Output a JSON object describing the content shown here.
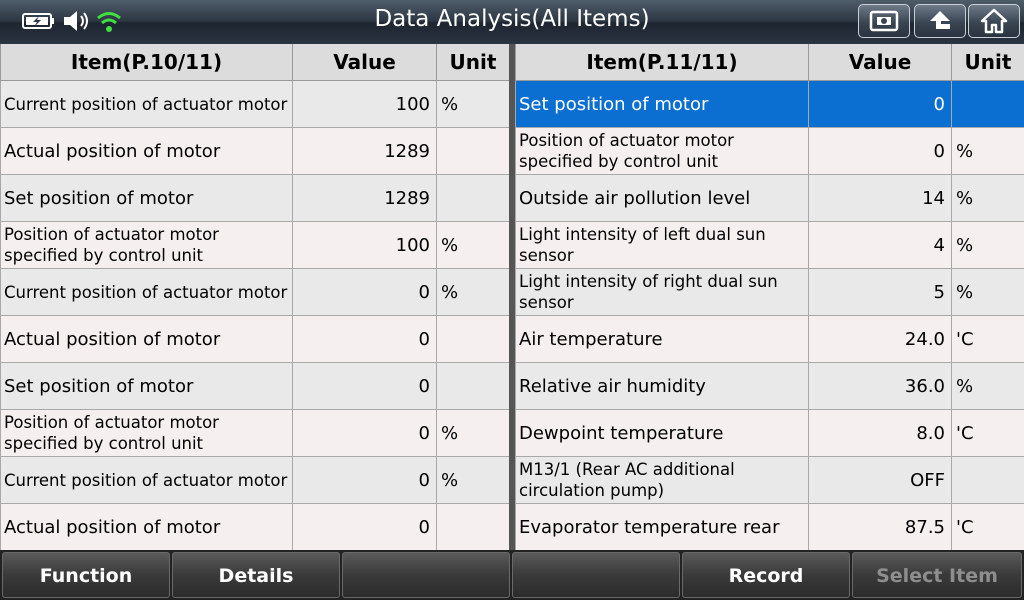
{
  "header": {
    "title": "Data Analysis(All Items)",
    "icons": [
      "battery-charging-icon",
      "speaker-icon",
      "wifi-icon"
    ],
    "buttons": [
      "screenshot-icon",
      "back-icon",
      "home-icon"
    ]
  },
  "left_table": {
    "headers": {
      "item": "Item(P.10/11)",
      "value": "Value",
      "unit": "Unit"
    },
    "rows": [
      {
        "item": "Current position of actuator motor",
        "value": "100",
        "unit": "%"
      },
      {
        "item": "Actual position of motor",
        "value": "1289",
        "unit": ""
      },
      {
        "item": "Set position of motor",
        "value": "1289",
        "unit": ""
      },
      {
        "item": "Position of actuator motor specified by control unit",
        "value": "100",
        "unit": "%"
      },
      {
        "item": "Current position of actuator motor",
        "value": "0",
        "unit": "%"
      },
      {
        "item": "Actual position of motor",
        "value": "0",
        "unit": ""
      },
      {
        "item": "Set position of motor",
        "value": "0",
        "unit": ""
      },
      {
        "item": "Position of actuator motor specified by control unit",
        "value": "0",
        "unit": "%"
      },
      {
        "item": "Current position of actuator motor",
        "value": "0",
        "unit": "%"
      },
      {
        "item": "Actual position of motor",
        "value": "0",
        "unit": ""
      }
    ]
  },
  "right_table": {
    "headers": {
      "item": "Item(P.11/11)",
      "value": "Value",
      "unit": "Unit"
    },
    "rows": [
      {
        "item": "Set position of motor",
        "value": "0",
        "unit": ""
      },
      {
        "item": "Position of actuator motor specified by control unit",
        "value": "0",
        "unit": "%"
      },
      {
        "item": "Outside air pollution level",
        "value": "14",
        "unit": "%"
      },
      {
        "item": "Light intensity of left dual sun sensor",
        "value": "4",
        "unit": "%"
      },
      {
        "item": "Light intensity of right dual sun sensor",
        "value": "5",
        "unit": "%"
      },
      {
        "item": "Air temperature",
        "value": "24.0",
        "unit": "'C"
      },
      {
        "item": "Relative air humidity",
        "value": "36.0",
        "unit": "%"
      },
      {
        "item": "Dewpoint temperature",
        "value": "8.0",
        "unit": "'C"
      },
      {
        "item": "M13/1 (Rear AC additional circulation pump)",
        "value": "OFF",
        "unit": ""
      },
      {
        "item": "Evaporator temperature rear",
        "value": "87.5",
        "unit": "'C"
      }
    ]
  },
  "bottom_buttons": [
    {
      "label": "Function",
      "name": "function-button"
    },
    {
      "label": "Details",
      "name": "details-button"
    },
    {
      "label": "",
      "name": "empty-button-3"
    },
    {
      "label": "",
      "name": "empty-button-4"
    },
    {
      "label": "Record",
      "name": "record-button"
    },
    {
      "label": "Select Item",
      "name": "select-item-button"
    }
  ]
}
